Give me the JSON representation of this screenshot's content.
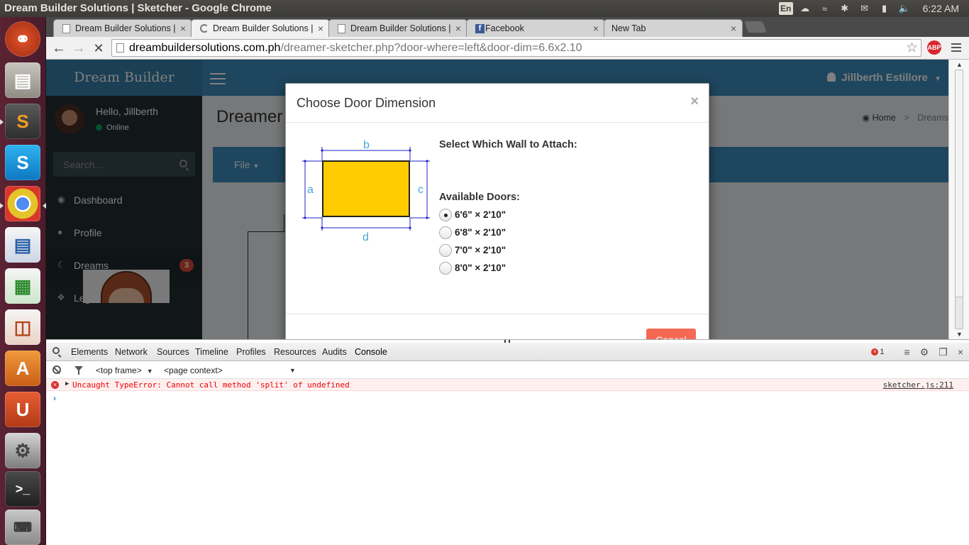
{
  "os": {
    "window_title": "Dream Builder Solutions | Sketcher - Google Chrome",
    "keyboard_layout": "En",
    "clock": "6:22 AM",
    "tray_icons": [
      "keyboard-layout-icon",
      "dropbox-icon",
      "wifi-icon",
      "bluetooth-icon",
      "mail-icon",
      "battery-icon",
      "volume-icon"
    ],
    "launcher_apps": [
      "ubuntu-dash",
      "files",
      "sublime-text",
      "skype",
      "chrome",
      "libreoffice-writer",
      "libreoffice-calc",
      "libreoffice-impress",
      "software-center",
      "ubuntu-one",
      "system-settings",
      "terminal",
      "firefox",
      "keyboard"
    ]
  },
  "browser": {
    "tabs": [
      {
        "label": "Dream Builder Solutions |",
        "icon": "page-icon"
      },
      {
        "label": "Dream Builder Solutions |",
        "icon": "loading-icon",
        "active": true
      },
      {
        "label": "Dream Builder Solutions |",
        "icon": "page-icon"
      },
      {
        "label": "Facebook",
        "icon": "facebook-icon"
      },
      {
        "label": "New Tab",
        "icon": "none"
      }
    ],
    "url_host": "dreambuildersolutions.com.ph",
    "url_path": "/dreamer-sketcher.php?door-where=left&door-dim=6.6x2.10",
    "extension_badge": "ABP"
  },
  "page": {
    "brand": "Dream Builder",
    "user_name": "Jillberth Estillore",
    "sidebar": {
      "greeting": "Hello, Jillberth",
      "status": "Online",
      "search_placeholder": "Search...",
      "items": [
        {
          "label": "Dashboard",
          "icon": "dashboard-icon"
        },
        {
          "label": "Profile",
          "icon": "user-icon"
        },
        {
          "label": "Dreams",
          "icon": "moon-icon",
          "badge": "3"
        },
        {
          "label": "Legend",
          "icon": "crosshair-icon"
        }
      ]
    },
    "content_title": "Dreamer",
    "breadcrumb": [
      "Home",
      "Dreams"
    ],
    "toolbar_menu": "File"
  },
  "modal": {
    "title": "Choose Door Dimension",
    "close_symbol": "×",
    "diagram_labels": {
      "top": "b",
      "left": "a",
      "right": "c",
      "bottom": "d"
    },
    "door_fill_color": "#ffcc00",
    "dimension_line_color": "#2222cc",
    "wall_label": "Select Which Wall to Attach:",
    "doors_label": "Available Doors:",
    "door_options": [
      {
        "label": "6'6\" × 2'10\"",
        "checked": true
      },
      {
        "label": "6'8\" × 2'10\"",
        "checked": false
      },
      {
        "label": "7'0\" × 2'10\"",
        "checked": false
      },
      {
        "label": "8'0\" × 2'10\"",
        "checked": false
      }
    ],
    "cancel_label": "Cancel"
  },
  "devtools": {
    "tabs": [
      "Elements",
      "Network",
      "Sources",
      "Timeline",
      "Profiles",
      "Resources",
      "Audits",
      "Console"
    ],
    "active_tab": "Console",
    "error_count": "1",
    "frame_select": "<top frame>",
    "context_select": "<page context>",
    "error_message": "Uncaught TypeError: Cannot call method 'split' of undefined",
    "error_source": "sketcher.js:211",
    "prompt": "›"
  }
}
